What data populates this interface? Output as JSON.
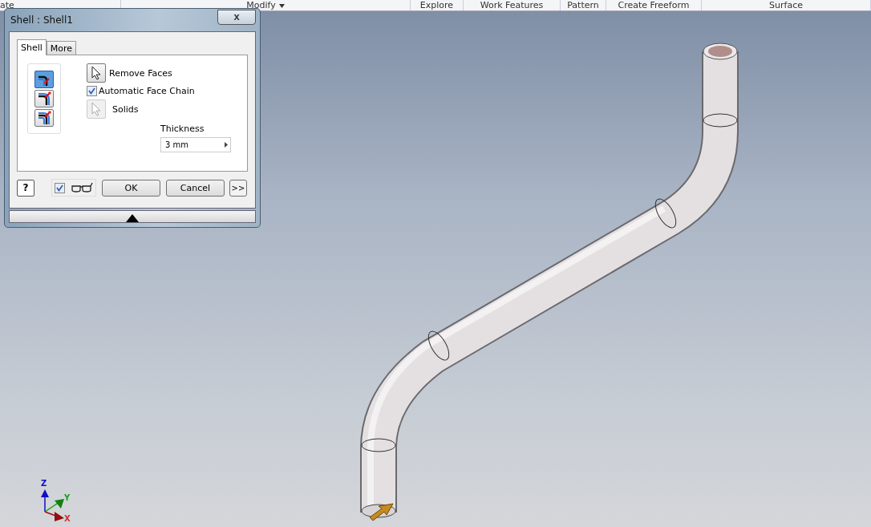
{
  "ribbon": {
    "panels": [
      {
        "label": "ate",
        "dropdown": false
      },
      {
        "label": "Modify",
        "dropdown": true
      },
      {
        "label": "Explore",
        "dropdown": false
      },
      {
        "label": "Work Features",
        "dropdown": false
      },
      {
        "label": "Pattern",
        "dropdown": false
      },
      {
        "label": "Create Freeform",
        "dropdown": false
      },
      {
        "label": "Surface",
        "dropdown": false
      }
    ]
  },
  "dialog": {
    "title": "Shell : Shell1",
    "close": "x",
    "tabs": [
      {
        "label": "Shell",
        "selected": true
      },
      {
        "label": "More",
        "selected": false
      }
    ],
    "modes": [
      {
        "kind": "inside",
        "selected": true
      },
      {
        "kind": "outside",
        "selected": false
      },
      {
        "kind": "both",
        "selected": false
      }
    ],
    "remove_faces": "Remove Faces",
    "face_chain": {
      "label": "Automatic Face Chain",
      "checked": true
    },
    "solids": {
      "label": "Solids",
      "disabled": true
    },
    "thickness": {
      "label": "Thickness",
      "value": "3 mm"
    },
    "preview": {
      "checked": true
    },
    "buttons": [
      {
        "label": "OK"
      },
      {
        "label": "Cancel"
      }
    ],
    "more": ">>",
    "help": "?"
  },
  "triad": {
    "x": "X",
    "y": "Y",
    "z": "Z"
  }
}
